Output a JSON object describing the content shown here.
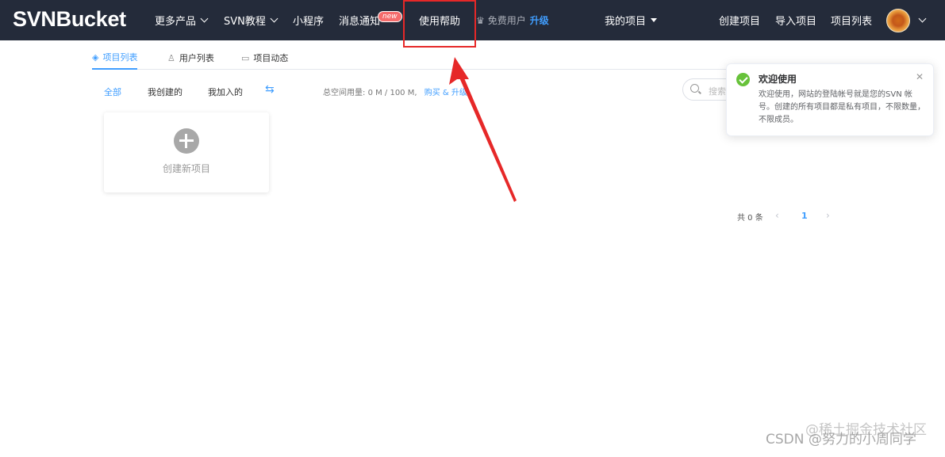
{
  "header": {
    "logo": "SVNBucket",
    "nav": {
      "more_products": "更多产品",
      "svn_tutorial": "SVN教程",
      "mini_program": "小程序",
      "messages": "消息通知",
      "messages_badge": "new",
      "help": "使用帮助",
      "free_user": "免费用户",
      "upgrade": "升级",
      "my_projects": "我的项目",
      "create_project": "创建项目",
      "import_project": "导入项目",
      "project_list": "项目列表"
    }
  },
  "tabs": [
    {
      "label": "项目列表",
      "active": true
    },
    {
      "label": "用户列表",
      "active": false
    },
    {
      "label": "项目动态",
      "active": false
    }
  ],
  "filters": {
    "all": "全部",
    "created_by_me": "我创建的",
    "joined_by_me": "我加入的"
  },
  "storage": {
    "label": "总空间用量:",
    "value": "0 M / 100 M,",
    "buy": "购买 & 升级"
  },
  "search": {
    "placeholder": "搜索"
  },
  "create_card": {
    "label": "创建新项目"
  },
  "pagination": {
    "total": "共 0 条",
    "current_page": "1"
  },
  "notification": {
    "title": "欢迎使用",
    "body": "欢迎使用，网站的登陆帐号就是您的SVN 帐号。创建的所有项目都是私有项目，不限数量，不限成员。"
  },
  "watermark": {
    "line1": "@稀土掘金技术社区",
    "line2": "CSDN @努力的小周同学"
  },
  "colors": {
    "header_bg": "#242b3a",
    "accent": "#409eff",
    "success": "#67c23a",
    "annotation_red": "#e62828"
  }
}
